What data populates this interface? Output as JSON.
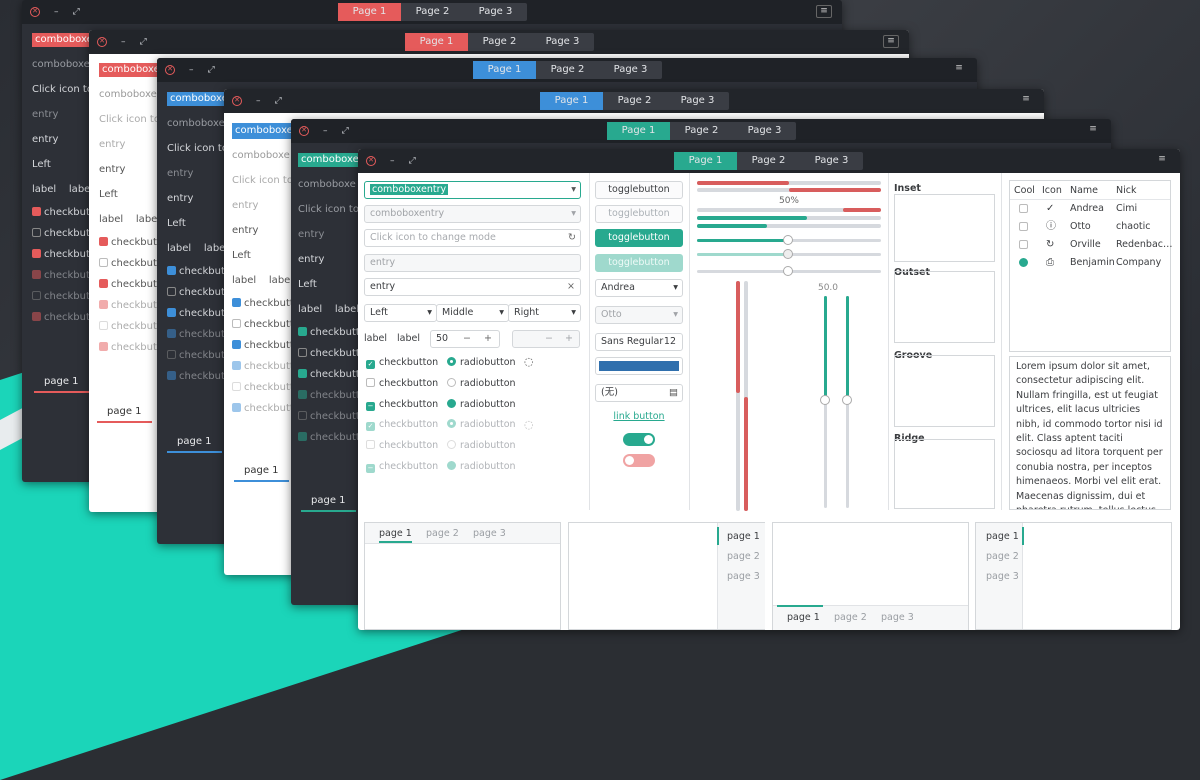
{
  "window_controls": {
    "close": "✕",
    "minimize": "–",
    "maximize": "⤢",
    "menu": "≡"
  },
  "header_tabs": [
    "Page 1",
    "Page 2",
    "Page 3"
  ],
  "accents": {
    "red": "#e55b5b",
    "blue": "#3d8fd9",
    "teal": "#28a98f"
  },
  "back_window": {
    "combo": "comboboxen",
    "combo_short": "comboboxe",
    "rows": [
      "comboboxen",
      "Click icon to",
      "entry",
      "entry",
      "Left",
      "label",
      "checkbutton"
    ],
    "labels": [
      "label",
      "label"
    ],
    "checkbutton": "checkbutton",
    "page_tab": "page 1"
  },
  "front": {
    "combo_entry_value": "comboboxentry",
    "combo_entry_disabled": "comboboxentry",
    "icon_placeholder": "Click icon to change mode",
    "entry_disabled": "entry",
    "entry_value": "entry",
    "align": [
      "Left",
      "Middle",
      "Right"
    ],
    "labels": [
      "label",
      "label"
    ],
    "spin_value": "50",
    "spin_minus": "−",
    "spin_plus": "+",
    "checkbutton": "checkbutton",
    "radiobutton": "radiobutton",
    "togglebutton": "togglebutton",
    "combo_andrea": "Andrea",
    "combo_otto": "Otto",
    "font": "Sans Regular",
    "font_size": "12",
    "file_none": "(无)",
    "link": "link button",
    "progress_label": "50%",
    "scale_label": "50.0",
    "progress_value": 0.5,
    "scale_value": 50,
    "frames": [
      "Inset",
      "Outset",
      "Groove",
      "Ridge"
    ],
    "tree_headers": [
      "Cool",
      "Icon",
      "Name",
      "Nick"
    ],
    "tree_rows": [
      {
        "name": "Andrea",
        "nick": "Cimi",
        "cool": true
      },
      {
        "name": "Otto",
        "nick": "chaotic",
        "cool": false
      },
      {
        "name": "Orville",
        "nick": "Redenbac…",
        "cool": true
      },
      {
        "name": "Benjamin",
        "nick": "Company",
        "cool": true
      }
    ],
    "lorem": "Lorem ipsum dolor sit amet, consectetur adipiscing elit. Nullam fringilla, est ut feugiat ultrices, elit lacus ultricies nibh, id commodo tortor nisi id elit. Class aptent taciti sociosqu ad litora torquent per conubia nostra, per inceptos himenaeos. Morbi vel elit erat. Maecenas dignissim, dui et pharetra rutrum, tellus lectus rutrum mi, a convallis",
    "notebook_tabs": [
      "page 1",
      "page 2",
      "page 3"
    ]
  }
}
